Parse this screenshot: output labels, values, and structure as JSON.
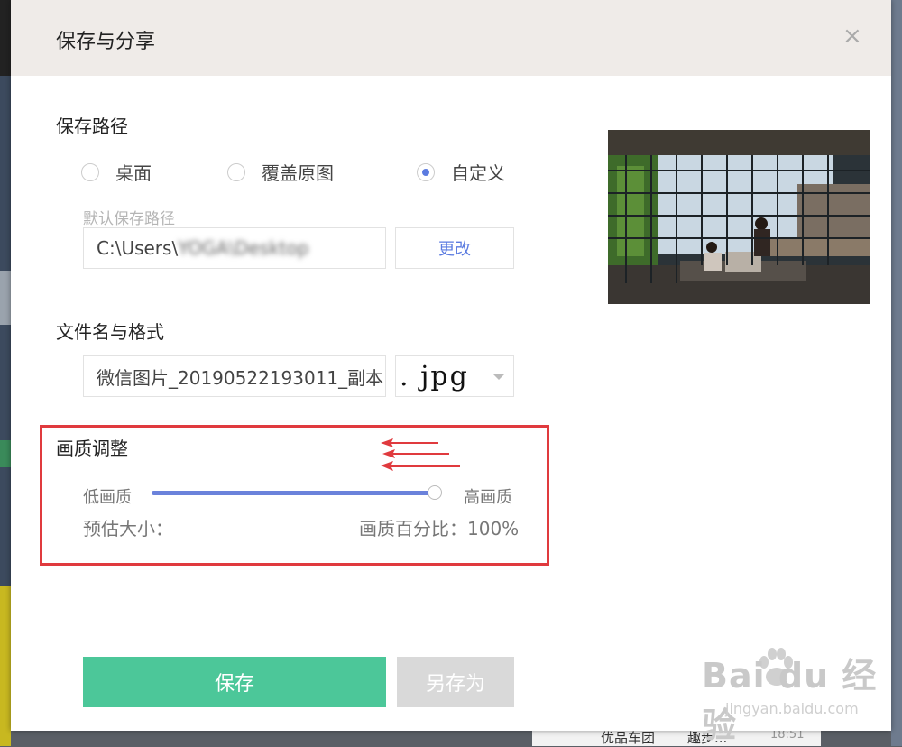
{
  "dialog": {
    "title": "保存与分享",
    "close_label": "×"
  },
  "save_path": {
    "title": "保存路径",
    "options": [
      {
        "label": "桌面",
        "checked": false
      },
      {
        "label": "覆盖原图",
        "checked": false
      },
      {
        "label": "自定义",
        "checked": true
      }
    ],
    "hint": "默认保存路径",
    "path_visible": "C:\\Users\\",
    "path_blurred": "YOGA\\Desktop",
    "change_label": "更改"
  },
  "file": {
    "title": "文件名与格式",
    "name": "微信图片_20190522193011_副本",
    "format": ". jpg"
  },
  "quality": {
    "title": "画质调整",
    "low_label": "低画质",
    "high_label": "高画质",
    "value_percent": 100,
    "estimated_size_label": "预估大小：",
    "percent_label": "画质百分比：100%"
  },
  "actions": {
    "save_label": "保存",
    "save_as_label": "另存为"
  },
  "watermark": {
    "brand": "Bai  du 经验",
    "url": "jingyan.baidu.com"
  },
  "background": {
    "taskbar_text": "优品车团",
    "taskbar_text2": "趣步...",
    "time": "18:51"
  },
  "colors": {
    "accent": "#5b7be0",
    "save_green": "#4cc799",
    "highlight_red": "#e03a3e"
  }
}
